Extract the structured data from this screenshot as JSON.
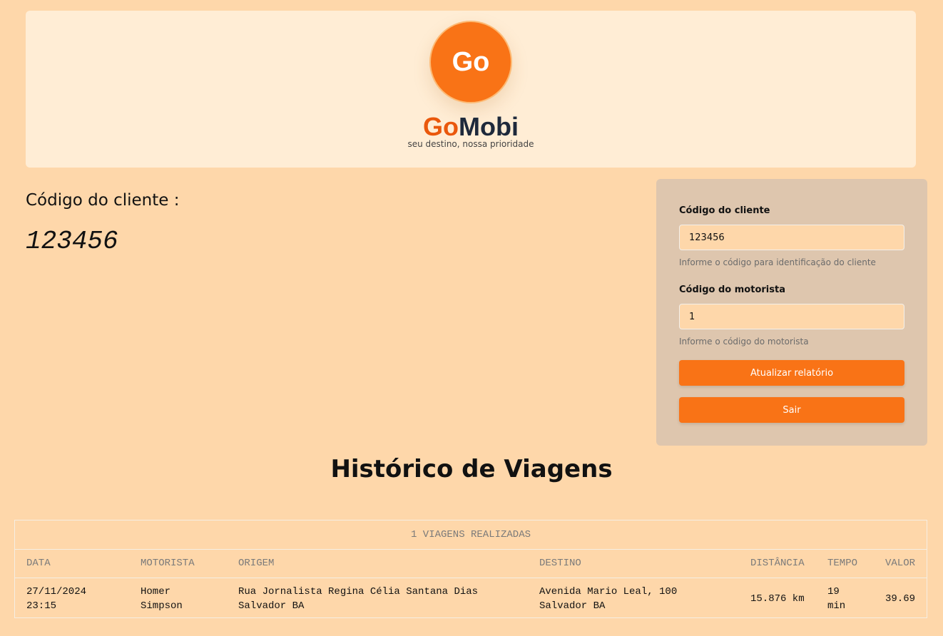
{
  "header": {
    "logo_text": "Go",
    "brand_go": "Go",
    "brand_mobi": "Mobi",
    "tagline": "seu destino, nossa prioridade"
  },
  "client": {
    "label": "Código do cliente :",
    "code": "123456"
  },
  "form": {
    "client_label": "Código do cliente",
    "client_value": "123456",
    "client_help": "Informe o código para identificação do cliente",
    "driver_label": "Código do motorista",
    "driver_value": "1",
    "driver_help": "Informe o código do motorista",
    "update_button": "Atualizar relatório",
    "exit_button": "Sair"
  },
  "history": {
    "title": "Histórico de Viagens",
    "caption": "1 VIAGENS REALIZADAS",
    "columns": [
      "DATA",
      "MOTORISTA",
      "ORIGEM",
      "DESTINO",
      "DISTÂNCIA",
      "TEMPO",
      "VALOR"
    ],
    "rows": [
      {
        "data": "27/11/2024 23:15",
        "motorista": "Homer Simpson",
        "origem": "Rua Jornalista Regina Célia Santana Dias Salvador BA",
        "destino": "Avenida Mario Leal, 100 Salvador BA",
        "distancia": "15.876 km",
        "tempo": "19 min",
        "valor": "39.69"
      }
    ]
  },
  "colors": {
    "background": "#fed7aa",
    "header_bg": "#ffedd5",
    "accent": "#f97316",
    "brand_go": "#ea580c",
    "brand_mobi": "#1e293b",
    "panel_bg": "#dec6ae"
  }
}
